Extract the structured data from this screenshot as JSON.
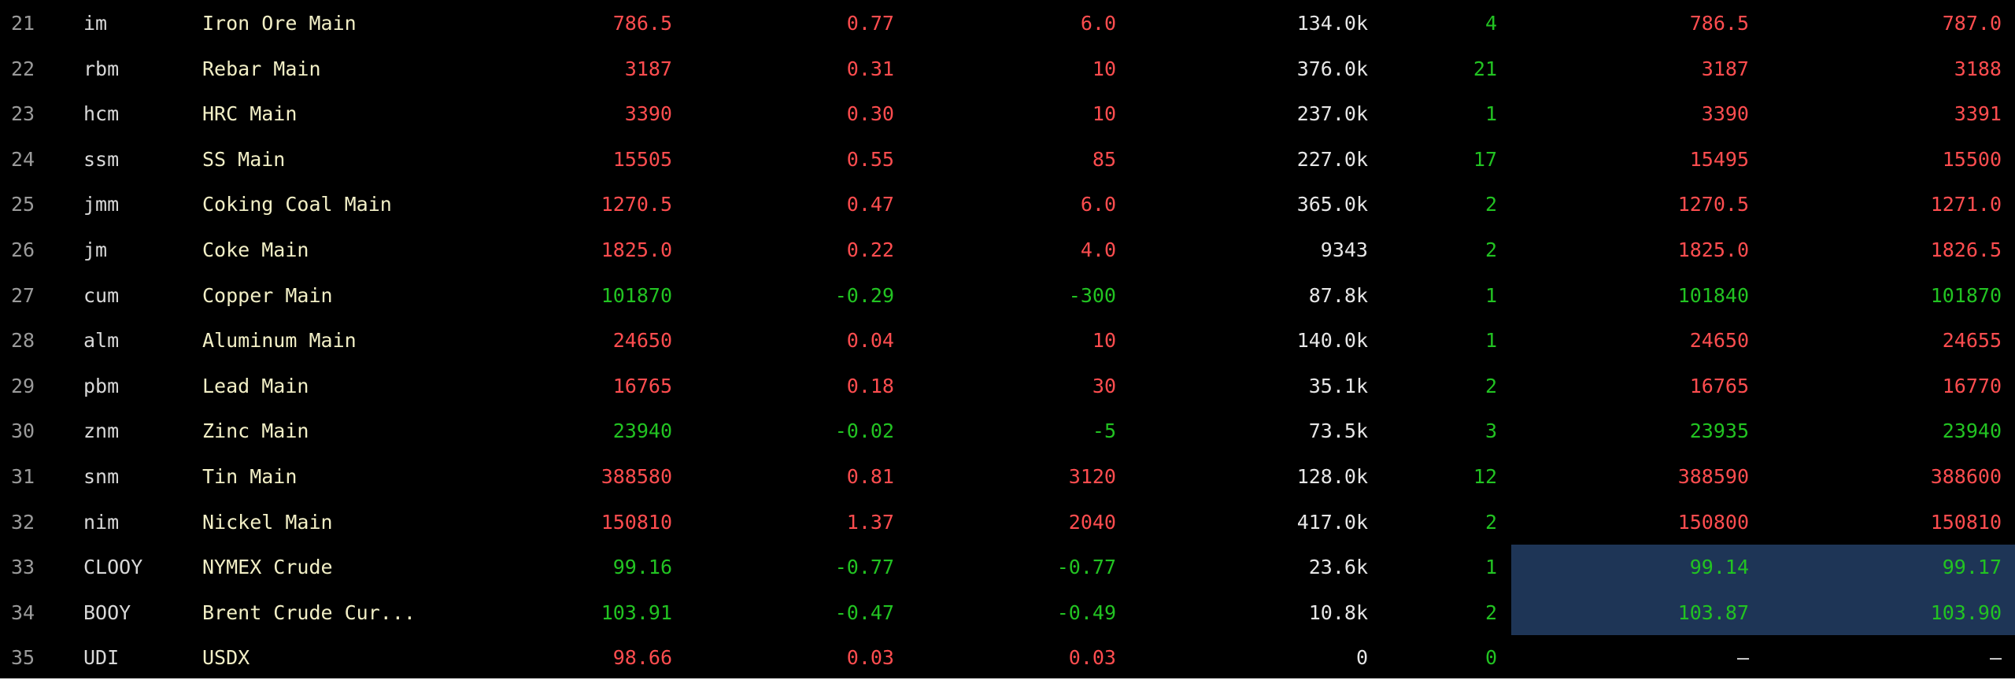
{
  "colors": {
    "up": "#ff4d4f",
    "down": "#22c322",
    "flat": "#e6e6e6",
    "qty": "#22c322",
    "highlight": "#1e3556"
  },
  "rows": [
    {
      "idx": "21",
      "code": "im",
      "name": "Iron Ore Main",
      "last": "786.5",
      "pct": "0.77",
      "chg": "6.0",
      "vol": "134.0k",
      "qty": "4",
      "bid": "786.5",
      "ask": "787.0",
      "dir": "up",
      "bid_dir": "up",
      "ask_dir": "up",
      "highlight": false
    },
    {
      "idx": "22",
      "code": "rbm",
      "name": "Rebar Main",
      "last": "3187",
      "pct": "0.31",
      "chg": "10",
      "vol": "376.0k",
      "qty": "21",
      "bid": "3187",
      "ask": "3188",
      "dir": "up",
      "bid_dir": "up",
      "ask_dir": "up",
      "highlight": false
    },
    {
      "idx": "23",
      "code": "hcm",
      "name": "HRC Main",
      "last": "3390",
      "pct": "0.30",
      "chg": "10",
      "vol": "237.0k",
      "qty": "1",
      "bid": "3390",
      "ask": "3391",
      "dir": "up",
      "bid_dir": "up",
      "ask_dir": "up",
      "highlight": false
    },
    {
      "idx": "24",
      "code": "ssm",
      "name": "SS Main",
      "last": "15505",
      "pct": "0.55",
      "chg": "85",
      "vol": "227.0k",
      "qty": "17",
      "bid": "15495",
      "ask": "15500",
      "dir": "up",
      "bid_dir": "up",
      "ask_dir": "up",
      "highlight": false
    },
    {
      "idx": "25",
      "code": "jmm",
      "name": "Coking Coal Main",
      "last": "1270.5",
      "pct": "0.47",
      "chg": "6.0",
      "vol": "365.0k",
      "qty": "2",
      "bid": "1270.5",
      "ask": "1271.0",
      "dir": "up",
      "bid_dir": "up",
      "ask_dir": "up",
      "highlight": false
    },
    {
      "idx": "26",
      "code": "jm",
      "name": "Coke Main",
      "last": "1825.0",
      "pct": "0.22",
      "chg": "4.0",
      "vol": "9343",
      "qty": "2",
      "bid": "1825.0",
      "ask": "1826.5",
      "dir": "up",
      "bid_dir": "up",
      "ask_dir": "up",
      "highlight": false
    },
    {
      "idx": "27",
      "code": "cum",
      "name": "Copper Main",
      "last": "101870",
      "pct": "-0.29",
      "chg": "-300",
      "vol": "87.8k",
      "qty": "1",
      "bid": "101840",
      "ask": "101870",
      "dir": "down",
      "bid_dir": "down",
      "ask_dir": "down",
      "highlight": false
    },
    {
      "idx": "28",
      "code": "alm",
      "name": "Aluminum Main",
      "last": "24650",
      "pct": "0.04",
      "chg": "10",
      "vol": "140.0k",
      "qty": "1",
      "bid": "24650",
      "ask": "24655",
      "dir": "up",
      "bid_dir": "up",
      "ask_dir": "up",
      "highlight": false
    },
    {
      "idx": "29",
      "code": "pbm",
      "name": "Lead Main",
      "last": "16765",
      "pct": "0.18",
      "chg": "30",
      "vol": "35.1k",
      "qty": "2",
      "bid": "16765",
      "ask": "16770",
      "dir": "up",
      "bid_dir": "up",
      "ask_dir": "up",
      "highlight": false
    },
    {
      "idx": "30",
      "code": "znm",
      "name": "Zinc Main",
      "last": "23940",
      "pct": "-0.02",
      "chg": "-5",
      "vol": "73.5k",
      "qty": "3",
      "bid": "23935",
      "ask": "23940",
      "dir": "down",
      "bid_dir": "down",
      "ask_dir": "down",
      "highlight": false
    },
    {
      "idx": "31",
      "code": "snm",
      "name": "Tin Main",
      "last": "388580",
      "pct": "0.81",
      "chg": "3120",
      "vol": "128.0k",
      "qty": "12",
      "bid": "388590",
      "ask": "388600",
      "dir": "up",
      "bid_dir": "up",
      "ask_dir": "up",
      "highlight": false
    },
    {
      "idx": "32",
      "code": "nim",
      "name": "Nickel Main",
      "last": "150810",
      "pct": "1.37",
      "chg": "2040",
      "vol": "417.0k",
      "qty": "2",
      "bid": "150800",
      "ask": "150810",
      "dir": "up",
      "bid_dir": "up",
      "ask_dir": "up",
      "highlight": false
    },
    {
      "idx": "33",
      "code": "CLOOY",
      "name": "NYMEX Crude",
      "last": "99.16",
      "pct": "-0.77",
      "chg": "-0.77",
      "vol": "23.6k",
      "qty": "1",
      "bid": "99.14",
      "ask": "99.17",
      "dir": "down",
      "bid_dir": "down",
      "ask_dir": "down",
      "highlight": true
    },
    {
      "idx": "34",
      "code": "BOOY",
      "name": "Brent Crude Cur...",
      "last": "103.91",
      "pct": "-0.47",
      "chg": "-0.49",
      "vol": "10.8k",
      "qty": "2",
      "bid": "103.87",
      "ask": "103.90",
      "dir": "down",
      "bid_dir": "down",
      "ask_dir": "down",
      "highlight": true
    },
    {
      "idx": "35",
      "code": "UDI",
      "name": "USDX",
      "last": "98.66",
      "pct": "0.03",
      "chg": "0.03",
      "vol": "0",
      "qty": "0",
      "bid": "–",
      "ask": "–",
      "dir": "up",
      "bid_dir": "flat",
      "ask_dir": "flat",
      "highlight": false
    }
  ]
}
